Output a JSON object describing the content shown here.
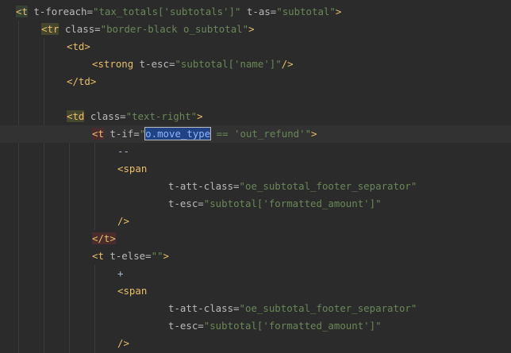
{
  "editor": {
    "lines": [
      {
        "indent": 20,
        "segments": [
          {
            "text": "<t",
            "cls": "tag t-green"
          },
          {
            "text": " t-foreach=",
            "cls": "attr"
          },
          {
            "text": "\"tax_totals['subtotals']\"",
            "cls": "val"
          },
          {
            "text": " t-as=",
            "cls": "attr"
          },
          {
            "text": "\"subtotal\"",
            "cls": "val"
          },
          {
            "text": ">",
            "cls": "punct"
          }
        ]
      },
      {
        "indent": 52,
        "segments": [
          {
            "text": "<tr",
            "cls": "tag t-olive"
          },
          {
            "text": " class=",
            "cls": "attr"
          },
          {
            "text": "\"border-black o_subtotal\"",
            "cls": "val"
          },
          {
            "text": ">",
            "cls": "punct"
          }
        ]
      },
      {
        "indent": 84,
        "segments": [
          {
            "text": "<td>",
            "cls": "tag"
          }
        ]
      },
      {
        "indent": 116,
        "segments": [
          {
            "text": "<strong",
            "cls": "tag"
          },
          {
            "text": " t-esc=",
            "cls": "attr"
          },
          {
            "text": "\"subtotal['name']\"",
            "cls": "val"
          },
          {
            "text": "/>",
            "cls": "punct"
          }
        ]
      },
      {
        "indent": 84,
        "segments": [
          {
            "text": "</td>",
            "cls": "tag"
          }
        ]
      },
      {
        "indent": 0,
        "segments": []
      },
      {
        "indent": 84,
        "segments": [
          {
            "text": "<td",
            "cls": "tag t-olive"
          },
          {
            "text": " class=",
            "cls": "attr"
          },
          {
            "text": "\"text-right\"",
            "cls": "val"
          },
          {
            "text": ">",
            "cls": "punct"
          }
        ]
      },
      {
        "indent": 116,
        "current": true,
        "segments": [
          {
            "text": "<t",
            "cls": "tag t-red"
          },
          {
            "text": " t-if=",
            "cls": "attr"
          },
          {
            "text": "\"",
            "cls": "val"
          },
          {
            "text": "o.move_type",
            "cls": "sel"
          },
          {
            "text": " == 'out_refund'\"",
            "cls": "val"
          },
          {
            "text": ">",
            "cls": "punct"
          }
        ]
      },
      {
        "indent": 148,
        "segments": [
          {
            "text": "--",
            "cls": "text"
          }
        ]
      },
      {
        "indent": 148,
        "segments": [
          {
            "text": "<span",
            "cls": "tag"
          }
        ]
      },
      {
        "indent": 212,
        "segments": [
          {
            "text": "t-att-class=",
            "cls": "attr"
          },
          {
            "text": "\"oe_subtotal_footer_separator\"",
            "cls": "val"
          }
        ]
      },
      {
        "indent": 212,
        "segments": [
          {
            "text": "t-esc=",
            "cls": "attr"
          },
          {
            "text": "\"subtotal['formatted_amount']\"",
            "cls": "val"
          }
        ]
      },
      {
        "indent": 148,
        "segments": [
          {
            "text": "/>",
            "cls": "punct"
          }
        ]
      },
      {
        "indent": 116,
        "segments": [
          {
            "text": "</t>",
            "cls": "tag t-red"
          }
        ]
      },
      {
        "indent": 116,
        "segments": [
          {
            "text": "<t",
            "cls": "tag"
          },
          {
            "text": " t-else=",
            "cls": "attr"
          },
          {
            "text": "\"\"",
            "cls": "val"
          },
          {
            "text": ">",
            "cls": "punct"
          }
        ]
      },
      {
        "indent": 148,
        "segments": [
          {
            "text": "+",
            "cls": "text"
          }
        ]
      },
      {
        "indent": 148,
        "segments": [
          {
            "text": "<span",
            "cls": "tag"
          }
        ]
      },
      {
        "indent": 212,
        "segments": [
          {
            "text": "t-att-class=",
            "cls": "attr"
          },
          {
            "text": "\"oe_subtotal_footer_separator\"",
            "cls": "val"
          }
        ]
      },
      {
        "indent": 212,
        "segments": [
          {
            "text": "t-esc=",
            "cls": "attr"
          },
          {
            "text": "\"subtotal['formatted_amount']\"",
            "cls": "val"
          }
        ]
      },
      {
        "indent": 148,
        "segments": [
          {
            "text": "/>",
            "cls": "punct"
          }
        ]
      }
    ]
  }
}
